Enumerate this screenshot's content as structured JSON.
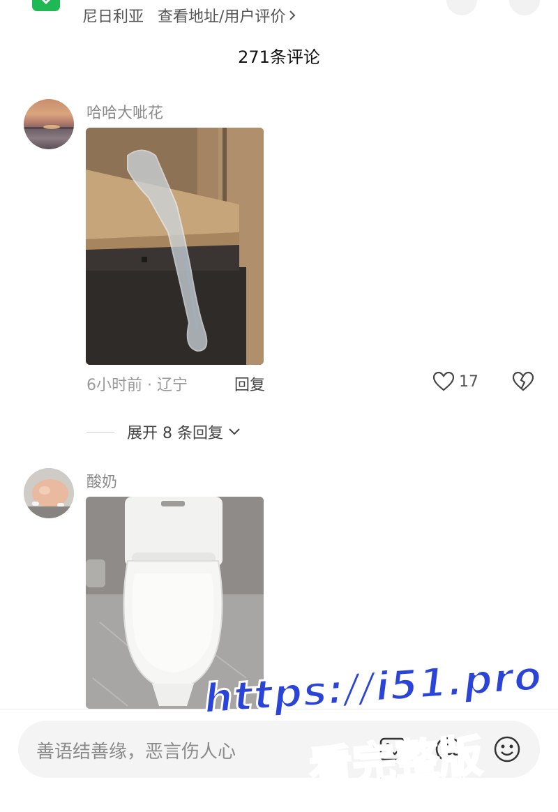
{
  "header": {
    "location_text": "尼日利亚",
    "link_text": "查看地址/用户评价"
  },
  "comments_header": {
    "count_label": "271条评论"
  },
  "comments": [
    {
      "username": "哈哈大呲花",
      "time_location": "6小时前 · 辽宁",
      "reply_label": "回复",
      "like_count": "17",
      "expand_label": "展开 8 条回复"
    },
    {
      "username": "酸奶"
    }
  ],
  "input_bar": {
    "placeholder": "善语结善缘，恶言伤人心",
    "icons": [
      "image-icon",
      "at-icon",
      "emoji-icon"
    ]
  },
  "watermark": {
    "line1": "https://i51.pro",
    "line2": "看完整版"
  },
  "colors": {
    "brand_green": "#1fb855",
    "watermark_blue": "#2a44d8"
  }
}
